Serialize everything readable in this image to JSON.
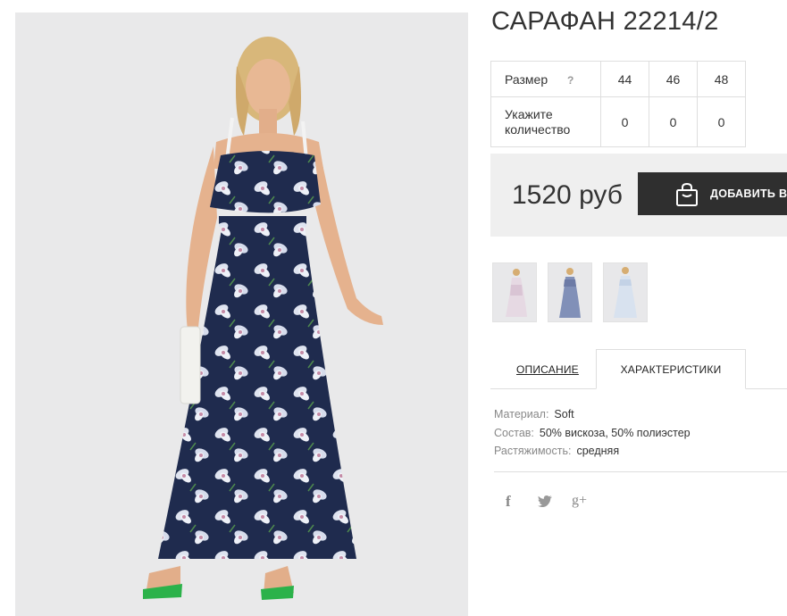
{
  "product": {
    "title": "САРАФАН 22214/2",
    "price": "1520 руб",
    "add_to_cart": "ДОБАВИТЬ В З"
  },
  "size_table": {
    "size_label": "Размер",
    "help": "?",
    "sizes": [
      "44",
      "46",
      "48"
    ],
    "qty_label": "Укажите количество",
    "quantities": [
      "0",
      "0",
      "0"
    ]
  },
  "tabs": {
    "description": "ОПИСАНИЕ",
    "characteristics": "ХАРАКТЕРИСТИКИ"
  },
  "specs": [
    {
      "key": "Материал:",
      "value": "Soft"
    },
    {
      "key": "Состав:",
      "value": "50% вискоза, 50% полиэстер"
    },
    {
      "key": "Растяжимость:",
      "value": "средняя"
    }
  ],
  "social": {
    "facebook": "f",
    "googleplus": "g+"
  },
  "colors": {
    "dress": "#1f2b4e",
    "flower": "#dfe4f0",
    "button": "#2f2f2f",
    "price_bg": "#efefef"
  }
}
